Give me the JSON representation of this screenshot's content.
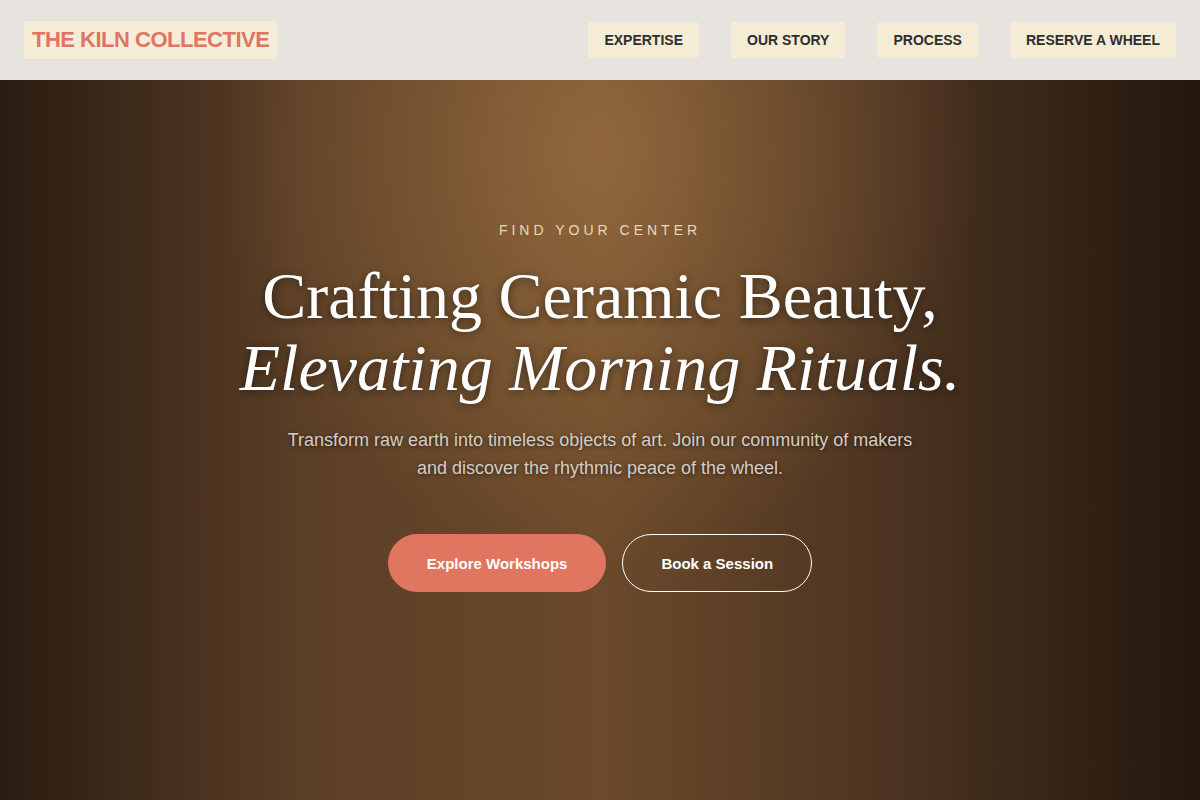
{
  "brand": "THE KILN COLLECTIVE",
  "nav": [
    {
      "label": "EXPERTISE"
    },
    {
      "label": "OUR STORY"
    },
    {
      "label": "PROCESS"
    },
    {
      "label": "RESERVE A WHEEL"
    }
  ],
  "hero": {
    "eyebrow": "FIND YOUR CENTER",
    "title_line1": "Crafting Ceramic Beauty,",
    "title_line2": "Elevating Morning Rituals.",
    "subtitle": "Transform raw earth into timeless objects of art. Join our community of makers and discover the rhythmic peace of the wheel.",
    "buttons": [
      {
        "label": "Explore Workshops",
        "kind": "primary"
      },
      {
        "label": "Book a Session",
        "kind": "outline"
      }
    ]
  }
}
